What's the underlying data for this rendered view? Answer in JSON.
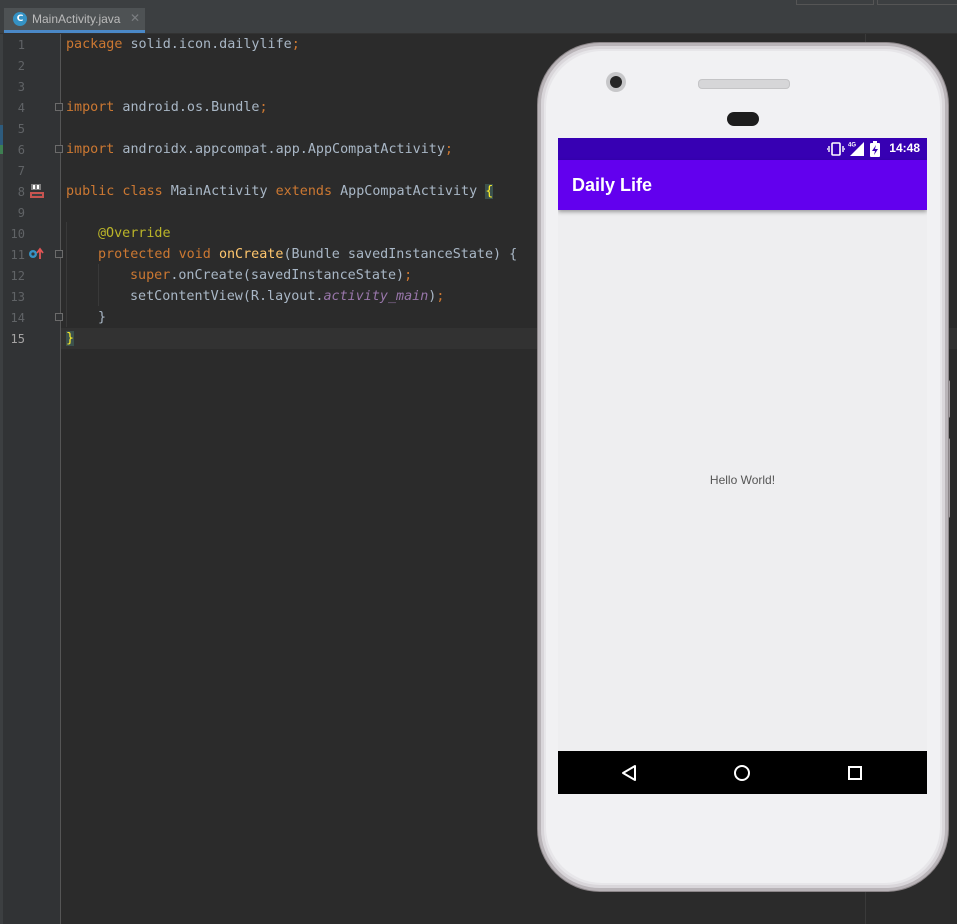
{
  "editor": {
    "tab": {
      "icon_letter": "C",
      "label": "MainActivity.java",
      "close": "✕"
    },
    "line_numbers": [
      "1",
      "2",
      "3",
      "4",
      "5",
      "6",
      "7",
      "8",
      "9",
      "10",
      "11",
      "12",
      "13",
      "14",
      "15"
    ],
    "code": {
      "l1": {
        "kw": "package",
        "rest": " solid.icon.dailylife",
        "semi": ";"
      },
      "l4": {
        "kw": "import",
        "rest": " android.os.Bundle",
        "semi": ";"
      },
      "l6": {
        "kw": "import",
        "rest": " androidx.appcompat.app.AppCompatActivity",
        "semi": ";"
      },
      "l8": {
        "kw1": "public class",
        "name": " MainActivity ",
        "kw2": "extends",
        "parent": " AppCompatActivity ",
        "brace": "{"
      },
      "l10": {
        "annotation": "@Override"
      },
      "l11": {
        "kw": "protected void",
        "fn": "onCreate",
        "rest": "(Bundle savedInstanceState) {"
      },
      "l12": {
        "kw": "super",
        "rest": ".onCreate(savedInstanceState)",
        "semi": ";"
      },
      "l13": {
        "pre": "setContentView(R.layout.",
        "field": "activity_main",
        "post": ")",
        "semi": ";"
      },
      "l14": {
        "brace": "}"
      },
      "l15": {
        "brace": "}"
      }
    },
    "gutter_icons": [
      "run-class-icon",
      "override-method-icon"
    ]
  },
  "device": {
    "status_bar": {
      "time": "14:48",
      "icons": [
        "vibrate-icon",
        "4g-signal-icon",
        "battery-charging-icon"
      ]
    },
    "app_bar": {
      "title": "Daily Life"
    },
    "content": {
      "text": "Hello World!"
    },
    "nav_bar": {
      "icons": [
        "back-icon",
        "home-icon",
        "recents-icon"
      ]
    }
  },
  "colors": {
    "editor_bg": "#2b2b2b",
    "keyword": "#cc7832",
    "annotation": "#bbb529",
    "function": "#ffc66d",
    "field": "#9876aa",
    "status_bar": "#3700b3",
    "app_bar": "#6200ee"
  }
}
